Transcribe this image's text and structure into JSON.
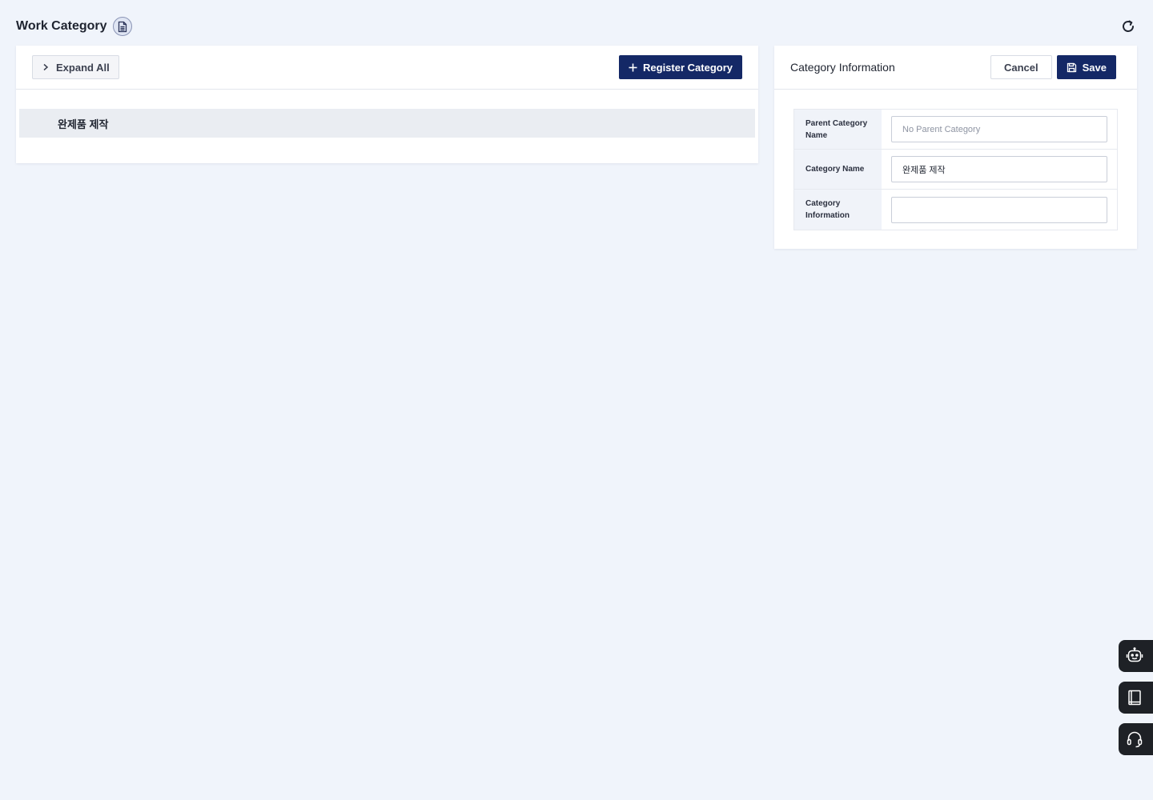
{
  "header": {
    "title": "Work Category",
    "doc_icon": "document-icon",
    "refresh_icon": "refresh-icon"
  },
  "tree_panel": {
    "expand_all_label": "Expand All",
    "register_label": "Register Category",
    "items": [
      {
        "label": "완제품 제작"
      }
    ]
  },
  "detail_panel": {
    "title": "Category Information",
    "cancel_label": "Cancel",
    "save_label": "Save",
    "fields": {
      "parent_label": "Parent Category Name",
      "parent_value": "",
      "parent_placeholder": "No Parent Category",
      "name_label": "Category Name",
      "name_value": "완제품 제작",
      "info_label": "Category Information",
      "info_value": ""
    }
  },
  "floating": [
    {
      "icon": "robot-icon"
    },
    {
      "icon": "book-icon"
    },
    {
      "icon": "headset-icon"
    }
  ],
  "colors": {
    "primary": "#142866",
    "background": "#f0f4fb",
    "floating_bg": "#1e2126"
  }
}
